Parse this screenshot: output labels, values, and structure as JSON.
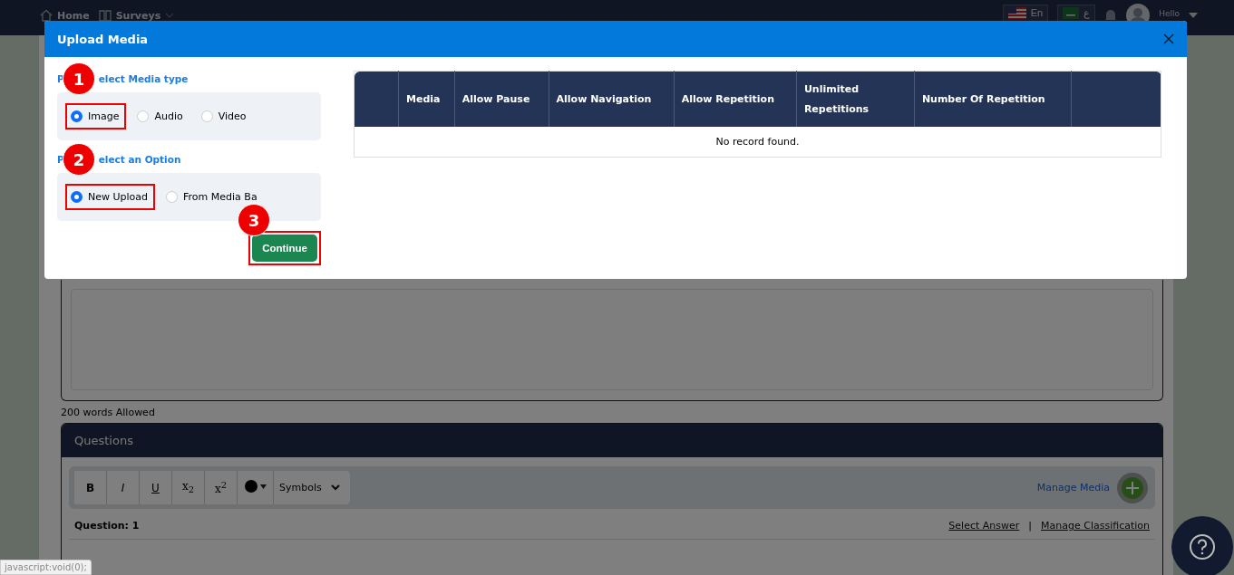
{
  "nav": {
    "items": [
      {
        "label": "Home",
        "kind": "home"
      },
      {
        "label": "Surveys",
        "kind": "surveys"
      }
    ],
    "languages": [
      {
        "label": "En",
        "kind": "us"
      },
      {
        "label": "ع",
        "kind": "sa"
      }
    ],
    "greeting": "Hello"
  },
  "page": {
    "word_limit": "200 words Allowed",
    "questions_title": "Questions",
    "toolbar": [
      "B",
      "I",
      "U",
      "x$_{2}$",
      "x$^{2}$"
    ],
    "symbols": "Symbols",
    "manage_media": "Manage Media",
    "question_label": "Question: 1",
    "links": [
      "Select Answer",
      "Manage Classification"
    ],
    "separator": "|"
  },
  "modal": {
    "title": "Upload Media",
    "media_type": {
      "label_start": "P",
      "label_end": "elect Media type",
      "badge": "1",
      "options": [
        {
          "label": "Image",
          "selected": true
        },
        {
          "label": "Audio",
          "selected": false
        },
        {
          "label": "Video",
          "selected": false
        }
      ]
    },
    "option": {
      "label_start": "P",
      "label_end": "elect an Option",
      "badge": "2",
      "options": [
        {
          "label": "New Upload",
          "selected": true
        },
        {
          "label": "From Media Ba",
          "selected": false
        }
      ]
    },
    "continue": {
      "label": "Continue",
      "badge": "3"
    },
    "table": {
      "columns": [
        "",
        "Media",
        "Allow Pause",
        "Allow Navigation",
        "Allow Repetition",
        "Unlimited Repetitions",
        "Number Of Repetition",
        ""
      ],
      "empty": "No record found."
    }
  },
  "status_url": "javascript:void(0);"
}
